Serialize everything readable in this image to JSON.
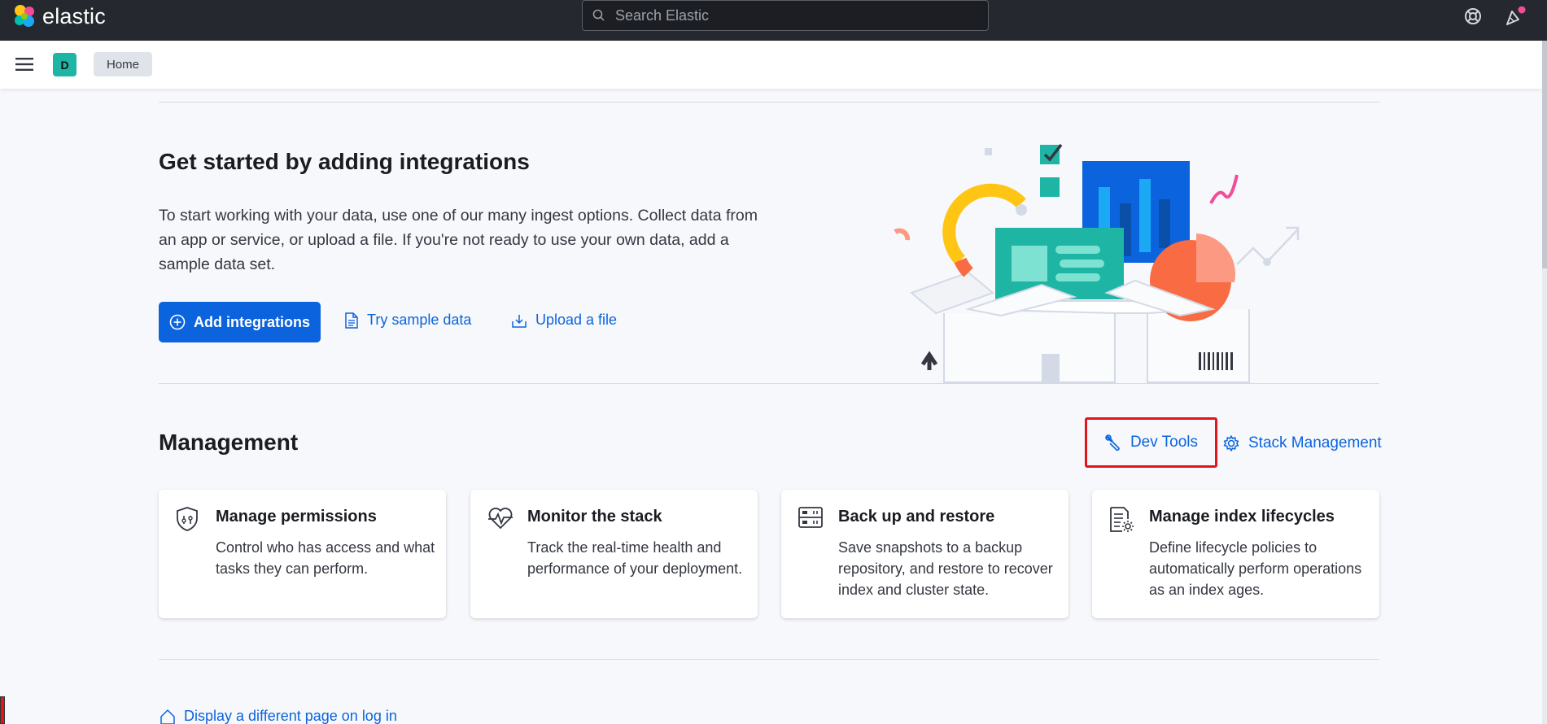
{
  "topbar": {
    "logo_text": "elastic",
    "search_placeholder": "Search Elastic"
  },
  "navbar": {
    "space_initial": "D",
    "breadcrumb": "Home"
  },
  "hero": {
    "title": "Get started by adding integrations",
    "description": "To start working with your data, use one of our many ingest options. Collect data from an app or service, or upload a file. If you're not ready to use your own data, add a sample data set.",
    "add_integrations": "Add integrations",
    "try_sample": "Try sample data",
    "upload_file": "Upload a file"
  },
  "management": {
    "title": "Management",
    "dev_tools": "Dev Tools",
    "stack_management": "Stack Management",
    "cards": [
      {
        "title": "Manage permissions",
        "desc": "Control who has access and what tasks they can perform."
      },
      {
        "title": "Monitor the stack",
        "desc": "Track the real-time health and performance of your deployment."
      },
      {
        "title": "Back up and restore",
        "desc": "Save snapshots to a backup repository, and restore to recover index and cluster state."
      },
      {
        "title": "Manage index lifecycles",
        "desc": "Define lifecycle policies to automatically perform operations as an index ages."
      }
    ]
  },
  "footer": {
    "link": "Display a different page on log in"
  },
  "colors": {
    "accent": "#0b64dd",
    "topbar": "#25282f",
    "highlight_box": "#e0161a"
  }
}
